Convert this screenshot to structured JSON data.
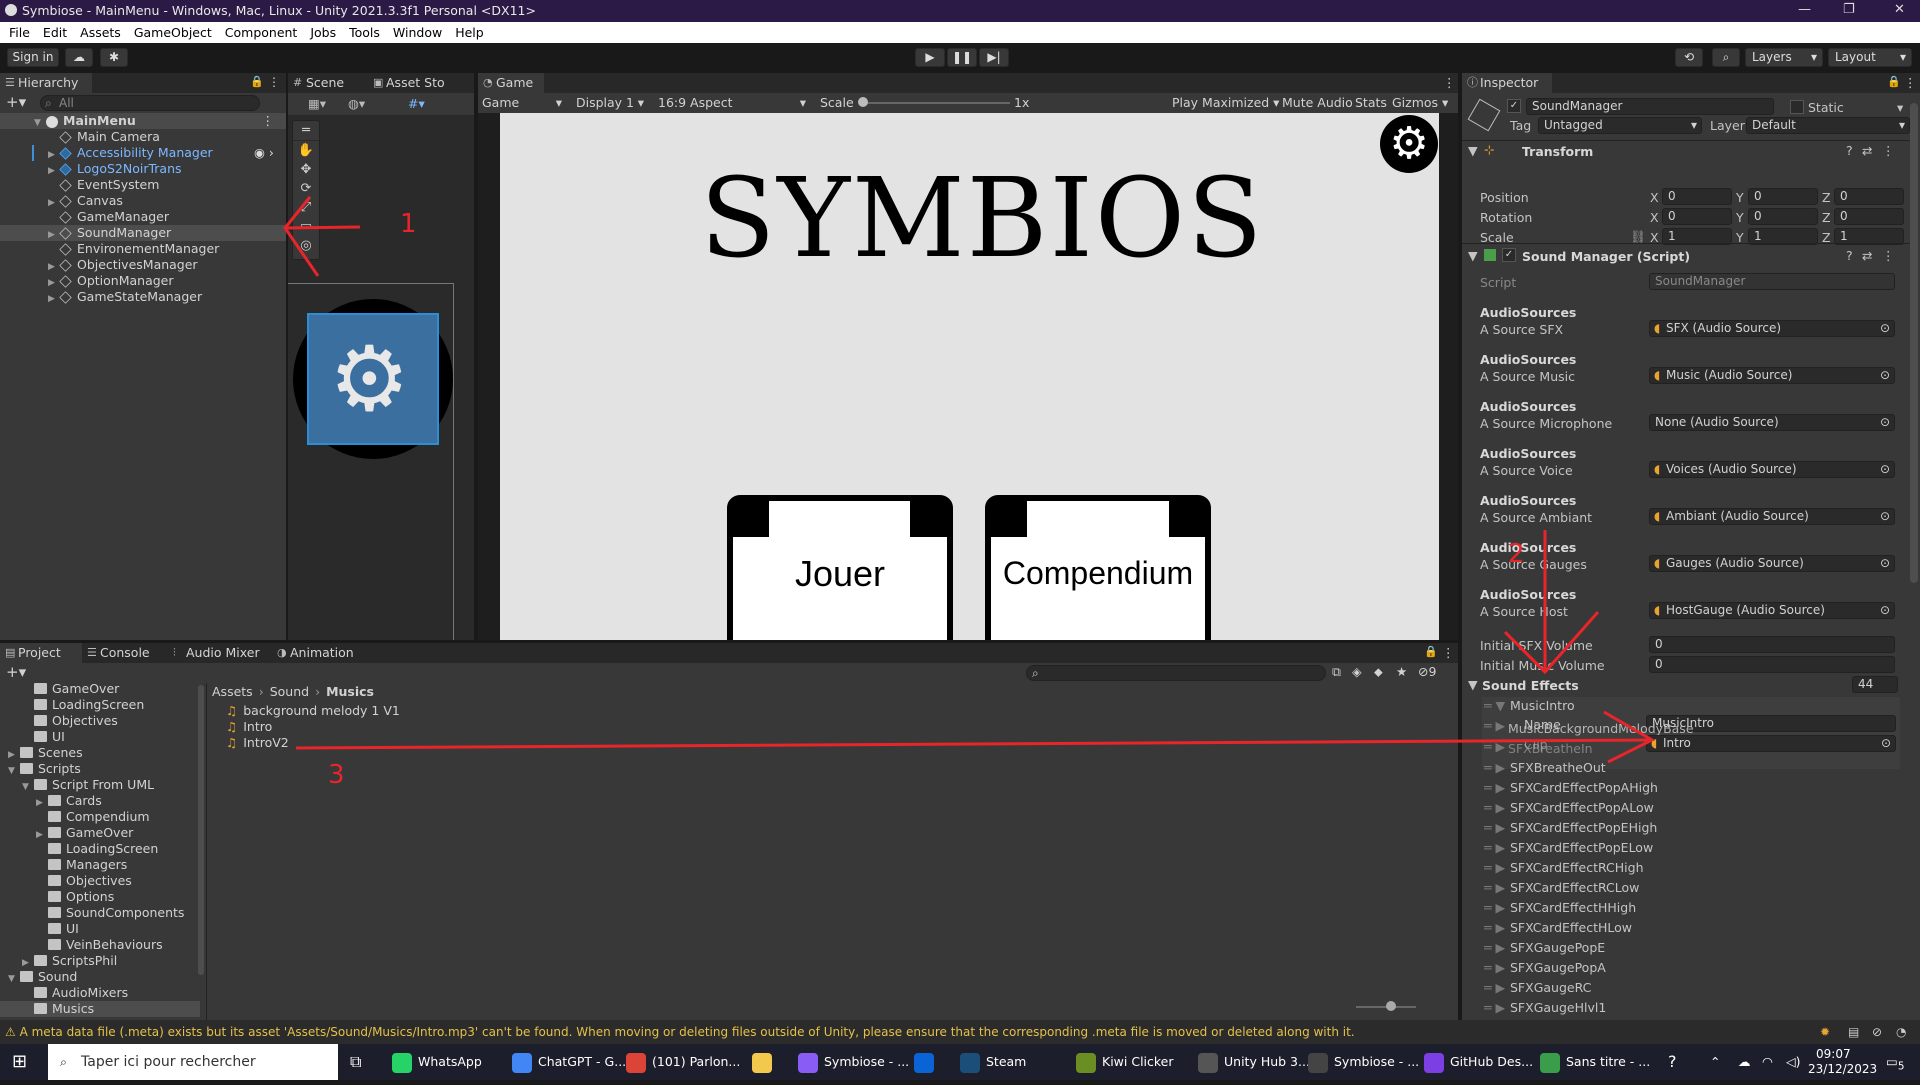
{
  "window": {
    "title": "Symbiose - MainMenu - Windows, Mac, Linux - Unity 2021.3.3f1 Personal <DX11>"
  },
  "menu": [
    "File",
    "Edit",
    "Assets",
    "GameObject",
    "Component",
    "Jobs",
    "Tools",
    "Window",
    "Help"
  ],
  "toolbar": {
    "sign_in": "Sign in",
    "layers": "Layers",
    "layout": "Layout"
  },
  "hierarchy": {
    "tab": "Hierarchy",
    "search_placeholder": "All",
    "root": "MainMenu",
    "items": [
      {
        "label": "Main Camera",
        "type": "go",
        "expand": false
      },
      {
        "label": "Accessibility Manager",
        "type": "prefab",
        "expand": true
      },
      {
        "label": "LogoS2NoirTrans",
        "type": "prefab",
        "expand": true
      },
      {
        "label": "EventSystem",
        "type": "go",
        "expand": false
      },
      {
        "label": "Canvas",
        "type": "go",
        "expand": true
      },
      {
        "label": "GameManager",
        "type": "go",
        "expand": false
      },
      {
        "label": "SoundManager",
        "type": "go",
        "expand": true
      },
      {
        "label": "EnvironementManager",
        "type": "go",
        "expand": false
      },
      {
        "label": "ObjectivesManager",
        "type": "go",
        "expand": true
      },
      {
        "label": "OptionManager",
        "type": "go",
        "expand": true
      },
      {
        "label": "GameStateManager",
        "type": "go",
        "expand": true
      }
    ]
  },
  "scene": {
    "tab_scene": "Scene",
    "tab_asset": "Asset Sto"
  },
  "game": {
    "tab": "Game",
    "display_mode": "Game",
    "display": "Display 1",
    "aspect": "16:9 Aspect",
    "scale_label": "Scale",
    "scale_value": "1x",
    "play_max": "Play Maximized",
    "mute": "Mute Audio",
    "stats": "Stats",
    "gizmos": "Gizmos",
    "logo": "SYMBIOS",
    "btn_play": "Jouer",
    "btn_compendium": "Compendium"
  },
  "inspector": {
    "tab": "Inspector",
    "object": "SoundManager",
    "static": "Static",
    "tag_label": "Tag",
    "tag": "Untagged",
    "layer_label": "Layer",
    "layer": "Default",
    "transform": {
      "title": "Transform",
      "rows": [
        {
          "label": "Position",
          "x": "0",
          "y": "0",
          "z": "0"
        },
        {
          "label": "Rotation",
          "x": "0",
          "y": "0",
          "z": "0"
        },
        {
          "label": "Scale",
          "x": "1",
          "y": "1",
          "z": "1"
        }
      ]
    },
    "script": {
      "title": "Sound Manager (Script)",
      "script_label": "Script",
      "script_value": "SoundManager",
      "sources": [
        {
          "header": "AudioSources",
          "label": "A Source SFX",
          "value": "SFX (Audio Source)",
          "icon": true
        },
        {
          "header": "AudioSources",
          "label": "A Source Music",
          "value": "Music (Audio Source)",
          "icon": true
        },
        {
          "header": "AudioSources",
          "label": "A Source Microphone",
          "value": "None (Audio Source)",
          "icon": false
        },
        {
          "header": "AudioSources",
          "label": "A Source Voice",
          "value": "Voices (Audio Source)",
          "icon": true
        },
        {
          "header": "AudioSources",
          "label": "A Source Ambiant",
          "value": "Ambiant (Audio Source)",
          "icon": true
        },
        {
          "header": "AudioSources",
          "label": "A Source Gauges",
          "value": "Gauges (Audio Source)",
          "icon": true
        },
        {
          "header": "AudioSources",
          "label": "A Source Host",
          "value": "HostGauge (Audio Source)",
          "icon": true
        }
      ],
      "sfx_volume_label": "Initial SFX Volume",
      "sfx_volume": "0",
      "music_volume_label": "Initial Music Volume",
      "music_volume": "0",
      "effects_label": "Sound Effects",
      "effects_count": "44",
      "first_effect": "MusicIntro",
      "name_label": "Name",
      "name_value": "MusicIntro",
      "clip_label": "Clip",
      "clip_value": "Intro",
      "second_effect": "MusicBackgroundMelodyBase",
      "third_effect": "SFXBreatheIn",
      "effects": [
        "SFXBreatheOut",
        "SFXCardEffectPopAHigh",
        "SFXCardEffectPopALow",
        "SFXCardEffectPopEHigh",
        "SFXCardEffectPopELow",
        "SFXCardEffectRCHigh",
        "SFXCardEffectRCLow",
        "SFXCardEffectHHigh",
        "SFXCardEffectHLow",
        "SFXGaugePopE",
        "SFXGaugePopA",
        "SFXGaugeRC",
        "SFXGaugeHlvl1"
      ]
    }
  },
  "bottom": {
    "tabs": [
      "Project",
      "Console",
      "Audio Mixer",
      "Animation"
    ],
    "breadcrumb": [
      "Assets",
      "Sound",
      "Musics"
    ],
    "tree": [
      {
        "label": "GameOver",
        "indent": 2,
        "arrow": false
      },
      {
        "label": "LoadingScreen",
        "indent": 2,
        "arrow": false
      },
      {
        "label": "Objectives",
        "indent": 2,
        "arrow": false
      },
      {
        "label": "UI",
        "indent": 2,
        "arrow": false
      },
      {
        "label": "Scenes",
        "indent": 1,
        "arrow": "right"
      },
      {
        "label": "Scripts",
        "indent": 1,
        "arrow": "down"
      },
      {
        "label": "Script From UML",
        "indent": 2,
        "arrow": "down"
      },
      {
        "label": "Cards",
        "indent": 3,
        "arrow": "right"
      },
      {
        "label": "Compendium",
        "indent": 3,
        "arrow": false
      },
      {
        "label": "GameOver",
        "indent": 3,
        "arrow": "right"
      },
      {
        "label": "LoadingScreen",
        "indent": 3,
        "arrow": false
      },
      {
        "label": "Managers",
        "indent": 3,
        "arrow": false
      },
      {
        "label": "Objectives",
        "indent": 3,
        "arrow": false
      },
      {
        "label": "Options",
        "indent": 3,
        "arrow": false
      },
      {
        "label": "SoundComponents",
        "indent": 3,
        "arrow": false
      },
      {
        "label": "UI",
        "indent": 3,
        "arrow": false
      },
      {
        "label": "VeinBehaviours",
        "indent": 3,
        "arrow": false
      },
      {
        "label": "ScriptsPhil",
        "indent": 2,
        "arrow": "right"
      },
      {
        "label": "Sound",
        "indent": 1,
        "arrow": "down"
      },
      {
        "label": "AudioMixers",
        "indent": 2,
        "arrow": false
      },
      {
        "label": "Musics",
        "indent": 2,
        "arrow": false,
        "selected": true
      }
    ],
    "files": [
      "background melody 1 V1",
      "Intro",
      "IntroV2"
    ],
    "hidden_count": "9"
  },
  "status": "A meta data file (.meta) exists but its asset 'Assets/Sound/Musics/Intro.mp3' can't be found. When moving or deleting files outside of Unity, please ensure that the corresponding .meta file is moved or deleted along with it.",
  "annotations": [
    "1",
    "2",
    "3"
  ],
  "taskbar": {
    "search": "Taper ici pour rechercher",
    "apps": [
      {
        "label": "WhatsApp",
        "color": "#25d366"
      },
      {
        "label": "ChatGPT - G...",
        "color": "#4285f4"
      },
      {
        "label": "(101) Parlon...",
        "color": "#db4437"
      },
      {
        "label": "",
        "color": "#f2c94c"
      },
      {
        "label": "Symbiose - ...",
        "color": "#8a5cf6"
      },
      {
        "label": "",
        "color": "#0a64d6"
      },
      {
        "label": "Steam",
        "color": "#1b4f7a"
      },
      {
        "label": "Kiwi Clicker",
        "color": "#6b8e23"
      },
      {
        "label": "Unity Hub 3....",
        "color": "#555"
      },
      {
        "label": "Symbiose - ...",
        "color": "#444"
      },
      {
        "label": "GitHub Des...",
        "color": "#7b3fe4"
      },
      {
        "label": "Sans titre - ...",
        "color": "#3a9d4a"
      }
    ],
    "time": "09:07",
    "date": "23/12/2023",
    "notif": "5"
  },
  "colors": {
    "accent": "#2c5d87",
    "link": "#7cb8ff",
    "annotation": "#e8252b"
  }
}
